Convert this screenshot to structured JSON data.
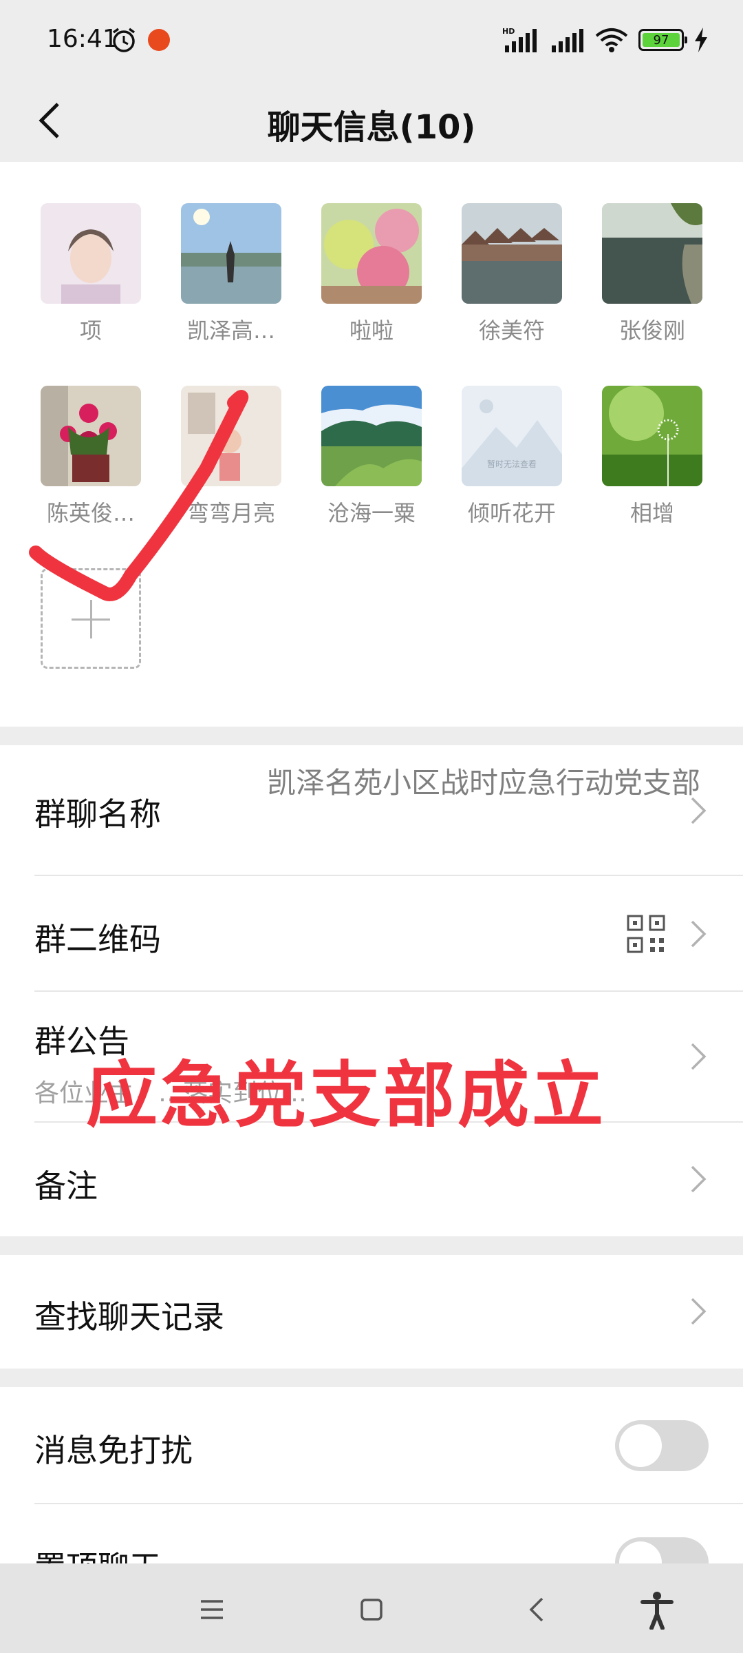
{
  "status_bar": {
    "time": "16:41",
    "battery_level": "97",
    "network_label": "HD"
  },
  "nav": {
    "title": "聊天信息(10)"
  },
  "members": [
    {
      "name": "项"
    },
    {
      "name": "凯泽高…"
    },
    {
      "name": "啦啦"
    },
    {
      "name": "徐美符"
    },
    {
      "name": "张俊刚"
    },
    {
      "name": "陈英俊…"
    },
    {
      "name": "弯弯月亮"
    },
    {
      "name": "沧海一粟"
    },
    {
      "name": "倾听花开"
    },
    {
      "name": "相增"
    }
  ],
  "placeholder_avatar_text": "暂时无法查看",
  "settings": {
    "group_name_label": "群聊名称",
    "group_name_value": "凯泽名苑小区战时应急行动党支部",
    "qr_label": "群二维码",
    "notice_label": "群公告",
    "notice_preview": "各位业主，…落实到位…",
    "remark_label": "备注",
    "search_label": "查找聊天记录",
    "mute_label": "消息免打扰",
    "pin_label": "置顶聊天"
  },
  "overlay": {
    "caption": "应急党支部成立"
  },
  "colors": {
    "accent_red": "#f0343f",
    "background": "#ededed"
  }
}
